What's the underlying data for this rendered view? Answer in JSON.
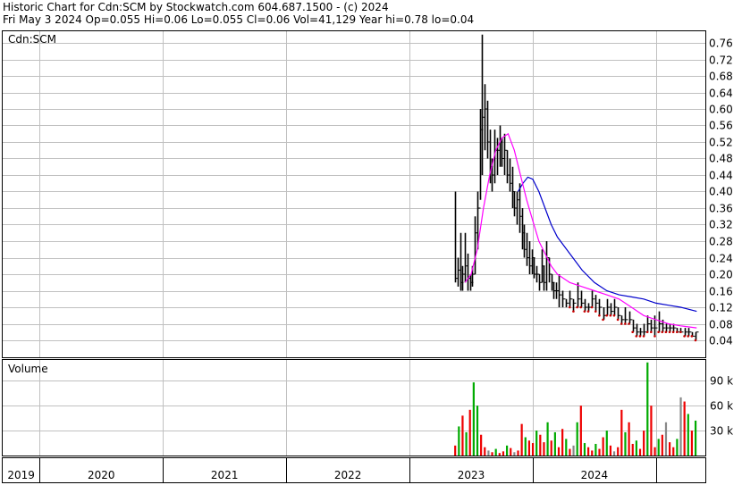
{
  "header": {
    "line1": "Historic Chart for Cdn:SCM by Stockwatch.com 604.687.1500 - (c) 2024",
    "line2": "Fri May  3 2024   Op=0.055  Hi=0.06  Lo=0.055  Cl=0.06  Vol=41,129  Year hi=0.78  lo=0.04"
  },
  "colors": {
    "candle": "#000000",
    "ma_short": "#ff00ff",
    "ma_long": "#0000cc",
    "vol_up": "#00aa00",
    "vol_down": "#ee0000",
    "vol_flat": "#888888",
    "grid": "#c0c0c0",
    "low_dots": "#cc0000"
  },
  "chart_data": [
    {
      "type": "line",
      "title": "Cdn:SCM",
      "ylim": [
        0.0,
        0.78
      ],
      "y_ticks": [
        0.04,
        0.08,
        0.12,
        0.16,
        0.2,
        0.24,
        0.28,
        0.32,
        0.36,
        0.4,
        0.44,
        0.48,
        0.52,
        0.56,
        0.6,
        0.64,
        0.68,
        0.72,
        0.76
      ],
      "x_ticks": [
        "2019",
        "2020",
        "2021",
        "2022",
        "2023",
        "2024"
      ],
      "xlim": [
        2018.7,
        2024.4
      ],
      "series": [
        {
          "style": "bars",
          "x": [
            2022.37,
            2022.39,
            2022.41,
            2022.43,
            2022.45,
            2022.47,
            2022.49,
            2022.51,
            2022.53,
            2022.55,
            2022.57,
            2022.59,
            2022.61,
            2022.63,
            2022.65,
            2022.67,
            2022.69,
            2022.71,
            2022.73,
            2022.75,
            2022.77,
            2022.79,
            2022.81,
            2022.83,
            2022.85,
            2022.87,
            2022.89,
            2022.91,
            2022.93,
            2022.95,
            2022.97,
            2022.99,
            2023.01,
            2023.03,
            2023.05,
            2023.07,
            2023.09,
            2023.11,
            2023.13,
            2023.15,
            2023.17,
            2023.19,
            2023.21,
            2023.24,
            2023.27,
            2023.3,
            2023.33,
            2023.36,
            2023.39,
            2023.42,
            2023.45,
            2023.48,
            2023.51,
            2023.54,
            2023.57,
            2023.6,
            2023.63,
            2023.66,
            2023.69,
            2023.72,
            2023.75,
            2023.78,
            2023.81,
            2023.84,
            2023.87,
            2023.9,
            2023.93,
            2023.96,
            2023.99,
            2024.02,
            2024.05,
            2024.08,
            2024.11,
            2024.14,
            2024.17,
            2024.2,
            2024.23,
            2024.26,
            2024.29,
            2024.32
          ],
          "high": [
            0.4,
            0.24,
            0.3,
            0.22,
            0.3,
            0.25,
            0.2,
            0.22,
            0.34,
            0.4,
            0.6,
            0.78,
            0.66,
            0.62,
            0.55,
            0.48,
            0.55,
            0.53,
            0.56,
            0.53,
            0.54,
            0.5,
            0.48,
            0.46,
            0.4,
            0.4,
            0.42,
            0.36,
            0.32,
            0.3,
            0.28,
            0.26,
            0.24,
            0.22,
            0.2,
            0.26,
            0.22,
            0.28,
            0.24,
            0.2,
            0.18,
            0.18,
            0.2,
            0.16,
            0.14,
            0.16,
            0.14,
            0.18,
            0.16,
            0.14,
            0.13,
            0.16,
            0.15,
            0.14,
            0.12,
            0.14,
            0.13,
            0.14,
            0.12,
            0.1,
            0.12,
            0.11,
            0.09,
            0.08,
            0.07,
            0.08,
            0.1,
            0.09,
            0.1,
            0.11,
            0.09,
            0.08,
            0.08,
            0.08,
            0.07,
            0.07,
            0.07,
            0.07,
            0.06,
            0.06
          ],
          "low": [
            0.18,
            0.17,
            0.16,
            0.16,
            0.18,
            0.16,
            0.16,
            0.17,
            0.2,
            0.26,
            0.38,
            0.44,
            0.5,
            0.48,
            0.42,
            0.4,
            0.42,
            0.44,
            0.46,
            0.46,
            0.44,
            0.42,
            0.4,
            0.36,
            0.34,
            0.32,
            0.3,
            0.26,
            0.24,
            0.22,
            0.2,
            0.2,
            0.19,
            0.18,
            0.16,
            0.18,
            0.16,
            0.16,
            0.18,
            0.16,
            0.14,
            0.14,
            0.12,
            0.12,
            0.12,
            0.12,
            0.11,
            0.12,
            0.12,
            0.11,
            0.11,
            0.12,
            0.11,
            0.1,
            0.09,
            0.1,
            0.1,
            0.1,
            0.09,
            0.08,
            0.08,
            0.08,
            0.06,
            0.05,
            0.05,
            0.05,
            0.06,
            0.06,
            0.05,
            0.06,
            0.06,
            0.06,
            0.06,
            0.06,
            0.06,
            0.06,
            0.05,
            0.05,
            0.05,
            0.04
          ],
          "close": [
            0.19,
            0.21,
            0.18,
            0.2,
            0.22,
            0.19,
            0.18,
            0.2,
            0.3,
            0.36,
            0.55,
            0.58,
            0.6,
            0.52,
            0.46,
            0.44,
            0.5,
            0.5,
            0.52,
            0.48,
            0.5,
            0.44,
            0.42,
            0.4,
            0.36,
            0.38,
            0.34,
            0.3,
            0.26,
            0.24,
            0.22,
            0.24,
            0.2,
            0.2,
            0.18,
            0.22,
            0.18,
            0.24,
            0.2,
            0.18,
            0.16,
            0.16,
            0.15,
            0.14,
            0.13,
            0.14,
            0.13,
            0.14,
            0.13,
            0.12,
            0.12,
            0.14,
            0.13,
            0.12,
            0.1,
            0.12,
            0.11,
            0.12,
            0.1,
            0.09,
            0.09,
            0.09,
            0.07,
            0.06,
            0.06,
            0.06,
            0.08,
            0.07,
            0.07,
            0.08,
            0.07,
            0.07,
            0.07,
            0.07,
            0.06,
            0.06,
            0.06,
            0.06,
            0.05,
            0.06
          ]
        },
        {
          "style": "ma_short",
          "x": [
            2022.45,
            2022.5,
            2022.55,
            2022.6,
            2022.65,
            2022.7,
            2022.75,
            2022.8,
            2022.85,
            2022.9,
            2022.95,
            2023.0,
            2023.05,
            2023.1,
            2023.15,
            2023.2,
            2023.3,
            2023.4,
            2023.5,
            2023.6,
            2023.7,
            2023.8,
            2023.9,
            2024.0,
            2024.1,
            2024.2,
            2024.33
          ],
          "values": [
            0.18,
            0.2,
            0.26,
            0.36,
            0.44,
            0.5,
            0.53,
            0.54,
            0.5,
            0.44,
            0.38,
            0.33,
            0.28,
            0.25,
            0.22,
            0.2,
            0.18,
            0.17,
            0.16,
            0.15,
            0.14,
            0.12,
            0.1,
            0.09,
            0.08,
            0.075,
            0.07
          ]
        },
        {
          "style": "ma_long",
          "x": [
            2022.88,
            2022.92,
            2022.96,
            2023.0,
            2023.05,
            2023.1,
            2023.15,
            2023.2,
            2023.3,
            2023.4,
            2023.5,
            2023.6,
            2023.7,
            2023.8,
            2023.9,
            2024.0,
            2024.1,
            2024.2,
            2024.33
          ],
          "values": [
            0.4,
            0.42,
            0.435,
            0.43,
            0.4,
            0.36,
            0.32,
            0.29,
            0.25,
            0.21,
            0.18,
            0.16,
            0.15,
            0.145,
            0.14,
            0.13,
            0.125,
            0.12,
            0.11
          ]
        }
      ]
    },
    {
      "type": "bar",
      "title": "Volume",
      "y_ticks": [
        "30 k",
        "60 k",
        "90 k"
      ],
      "y_tick_values": [
        30000,
        60000,
        90000
      ],
      "ylim": [
        0,
        115000
      ],
      "x": [
        2022.37,
        2022.4,
        2022.43,
        2022.46,
        2022.49,
        2022.52,
        2022.55,
        2022.58,
        2022.61,
        2022.64,
        2022.67,
        2022.7,
        2022.73,
        2022.76,
        2022.79,
        2022.82,
        2022.85,
        2022.88,
        2022.91,
        2022.94,
        2022.97,
        2023.0,
        2023.03,
        2023.06,
        2023.09,
        2023.12,
        2023.15,
        2023.18,
        2023.21,
        2023.24,
        2023.27,
        2023.3,
        2023.33,
        2023.36,
        2023.39,
        2023.42,
        2023.45,
        2023.48,
        2023.51,
        2023.54,
        2023.57,
        2023.6,
        2023.63,
        2023.66,
        2023.69,
        2023.72,
        2023.75,
        2023.78,
        2023.81,
        2023.84,
        2023.87,
        2023.9,
        2023.93,
        2023.96,
        2023.99,
        2024.02,
        2024.05,
        2024.08,
        2024.11,
        2024.14,
        2024.17,
        2024.2,
        2024.23,
        2024.26,
        2024.29,
        2024.32
      ],
      "values": [
        12000,
        35000,
        48000,
        28000,
        55000,
        88000,
        60000,
        25000,
        10000,
        6000,
        4000,
        8000,
        3000,
        5000,
        12000,
        9000,
        4000,
        6000,
        38000,
        22000,
        18000,
        15000,
        30000,
        25000,
        16000,
        40000,
        18000,
        28000,
        10000,
        32000,
        20000,
        8000,
        12000,
        40000,
        60000,
        15000,
        10000,
        6000,
        14000,
        8000,
        22000,
        30000,
        12000,
        5000,
        10000,
        55000,
        28000,
        40000,
        14000,
        18000,
        8000,
        30000,
        112000,
        60000,
        10000,
        20000,
        25000,
        40000,
        16000,
        10000,
        20000,
        70000,
        65000,
        50000,
        30000,
        42000
      ],
      "direction": [
        "down",
        "up",
        "down",
        "up",
        "down",
        "up",
        "up",
        "down",
        "down",
        "flat",
        "down",
        "up",
        "down",
        "down",
        "up",
        "down",
        "flat",
        "down",
        "down",
        "up",
        "down",
        "down",
        "up",
        "down",
        "down",
        "up",
        "down",
        "up",
        "down",
        "down",
        "up",
        "down",
        "flat",
        "up",
        "down",
        "up",
        "down",
        "down",
        "up",
        "down",
        "down",
        "up",
        "down",
        "flat",
        "down",
        "down",
        "up",
        "down",
        "down",
        "up",
        "down",
        "down",
        "up",
        "down",
        "down",
        "up",
        "down",
        "flat",
        "down",
        "down",
        "up",
        "flat",
        "down",
        "up",
        "down",
        "up"
      ]
    }
  ]
}
